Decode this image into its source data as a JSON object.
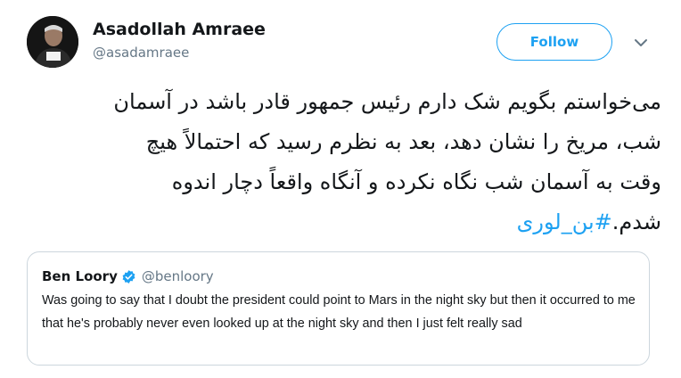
{
  "author": {
    "name": "Asadollah Amraee",
    "handle": "@asadamraee"
  },
  "follow_label": "Follow",
  "tweet": {
    "text_lines": [
      "می‌خواستم بگویم شک دارم رئیس جمهور قادر باشد در آسمان",
      "شب، مریخ را نشان دهد، بعد به نظرم رسید که احتمالاً هیچ",
      "وقت به آسمان شب نگاه نکرده و آنگاه واقعاً دچار اندوه"
    ],
    "last_line_text": "شدم.",
    "hashtag": "#بن_لوری"
  },
  "quoted_tweet": {
    "name": "Ben Loory",
    "handle": "@benloory",
    "text": "Was going to say that I doubt the president could point to Mars in the night sky but then it occurred to me that he's probably never even looked up at the night sky and then I just felt really sad"
  },
  "colors": {
    "accent": "#1da1f2",
    "secondary_text": "#657786",
    "border": "#ccd6dd"
  },
  "icons": [
    "avatar-photo",
    "chevron-down-icon",
    "verified-badge-icon"
  ]
}
